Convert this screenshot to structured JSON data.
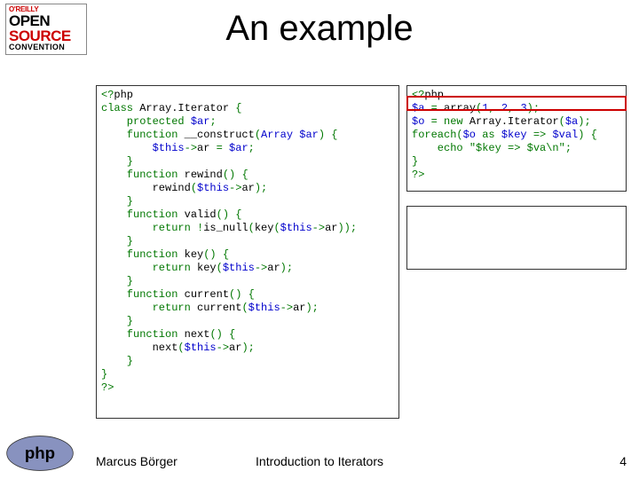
{
  "logo": {
    "line1": "O'REILLY",
    "line2": "OPEN",
    "line3": "SOURCE",
    "line4": "CONVENTION"
  },
  "title": "An example",
  "code_left": {
    "l1a": "<?",
    "l1b": "php",
    "l2a": "class ",
    "l2b": "Array.Iterator ",
    "l2c": "{",
    "l3a": "    protected ",
    "l3b": "$ar",
    "l3c": ";",
    "l4a": "    function ",
    "l4b": "__construct",
    "l4c": "(",
    "l4d": "Array $ar",
    "l4e": ") {",
    "l5a": "        ",
    "l5b": "$this",
    "l5c": "->",
    "l5d": "ar ",
    "l5e": "= ",
    "l5f": "$ar",
    "l5g": ";",
    "l6": "    }",
    "l7a": "    function ",
    "l7b": "rewind",
    "l7c": "() {",
    "l8a": "        ",
    "l8b": "rewind",
    "l8c": "(",
    "l8d": "$this",
    "l8e": "->",
    "l8f": "ar",
    "l8g": ");",
    "l9": "    }",
    "l10a": "    function ",
    "l10b": "valid",
    "l10c": "() {",
    "l11a": "        return !",
    "l11b": "is_null",
    "l11c": "(",
    "l11d": "key",
    "l11e": "(",
    "l11f": "$this",
    "l11g": "->",
    "l11h": "ar",
    "l11i": "));",
    "l12": "    }",
    "l13a": "    function ",
    "l13b": "key",
    "l13c": "() {",
    "l14a": "        return ",
    "l14b": "key",
    "l14c": "(",
    "l14d": "$this",
    "l14e": "->",
    "l14f": "ar",
    "l14g": ");",
    "l15": "    }",
    "l16a": "    function ",
    "l16b": "current",
    "l16c": "() {",
    "l17a": "        return ",
    "l17b": "current",
    "l17c": "(",
    "l17d": "$this",
    "l17e": "->",
    "l17f": "ar",
    "l17g": ");",
    "l18": "    }",
    "l19a": "    function ",
    "l19b": "next",
    "l19c": "() {",
    "l20a": "        ",
    "l20b": "next",
    "l20c": "(",
    "l20d": "$this",
    "l20e": "->",
    "l20f": "ar",
    "l20g": ");",
    "l21": "    }",
    "l22": "}",
    "l23a": "?",
    "l23b": ">"
  },
  "code_right": {
    "r1a": "<?",
    "r1b": "php",
    "r2a": "$a ",
    "r2b": "= ",
    "r2c": "array",
    "r2d": "(",
    "r2e": "1",
    "r2f": ", ",
    "r2g": "2",
    "r2h": ", ",
    "r2i": "3",
    "r2j": ");",
    "r3a": "$o ",
    "r3b": "= new ",
    "r3c": "Array.Iterator",
    "r3d": "(",
    "r3e": "$a",
    "r3f": ");",
    "r4a": "foreach(",
    "r4b": "$o ",
    "r4c": "as ",
    "r4d": "$key ",
    "r4e": "=> ",
    "r4f": "$val",
    "r4g": ") {",
    "r5a": "    echo ",
    "r5b": "\"$key => $va\\n\"",
    "r5c": ";",
    "r6": "}",
    "r7a": "?",
    "r7b": ">"
  },
  "footer": {
    "author": "Marcus Börger",
    "subject": "Introduction to Iterators",
    "page": "4"
  },
  "php_logo_text": "php"
}
